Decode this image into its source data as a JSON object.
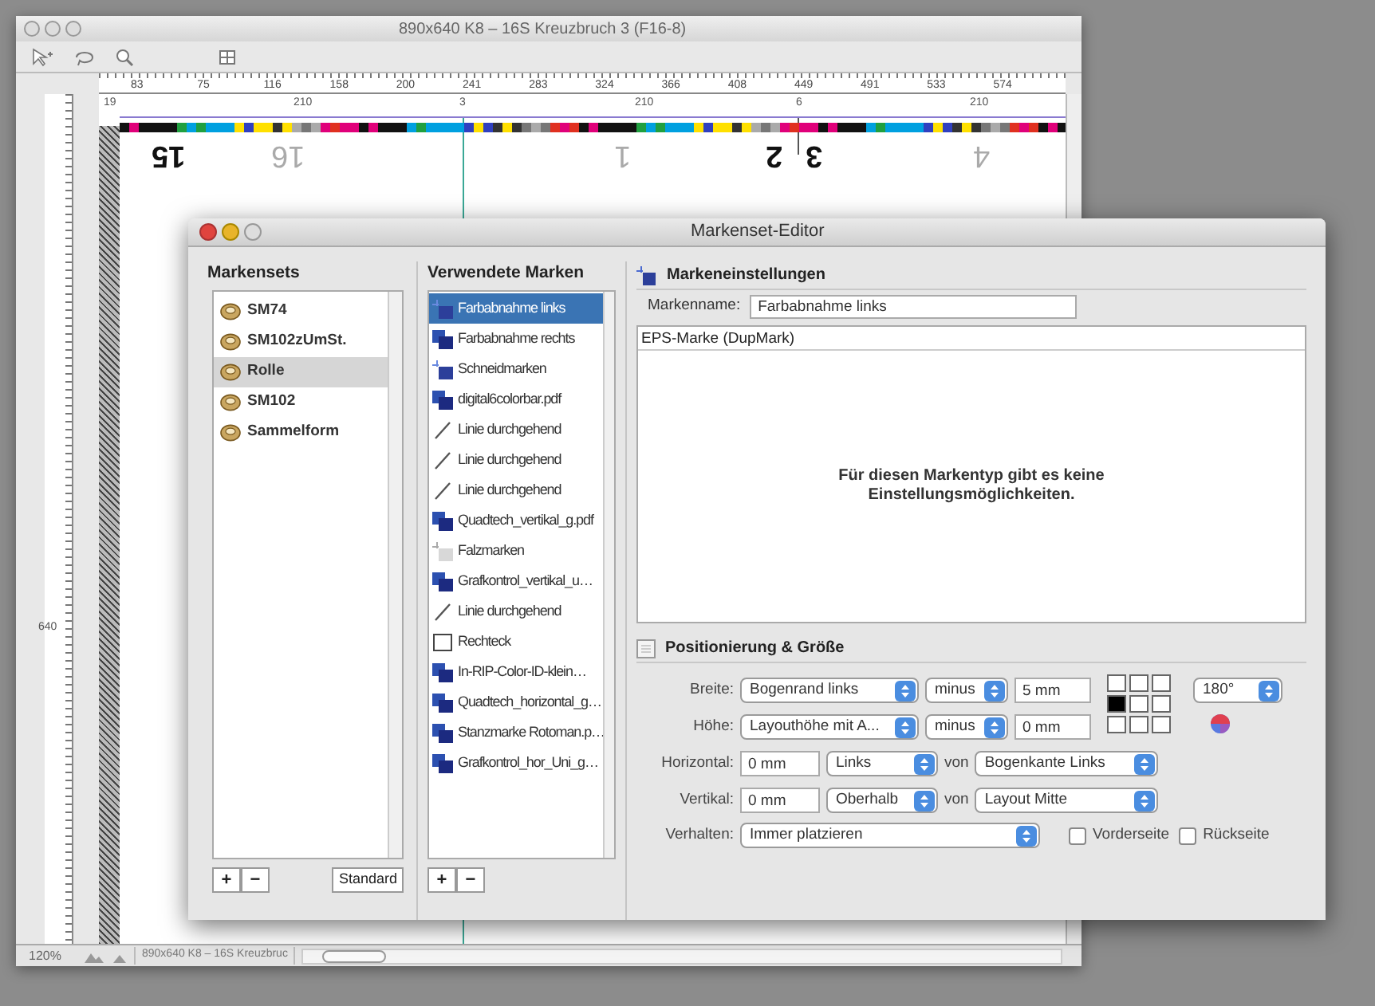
{
  "back_window": {
    "title": "890x640 K8 – 16S Kreuzbruch 3 (F16-8)",
    "ruler_ticks": [
      "83",
      "75",
      "116",
      "158",
      "200",
      "241",
      "283",
      "324",
      "366",
      "408",
      "449",
      "491",
      "533",
      "574"
    ],
    "sheet_labels": [
      {
        "text": "19"
      },
      {
        "text": "210"
      },
      {
        "text": "3"
      },
      {
        "text": "210"
      },
      {
        "text": "6"
      },
      {
        "text": "210"
      }
    ],
    "page_numbers": [
      {
        "text": "15",
        "highlighted": true
      },
      {
        "text": "16",
        "highlighted": false
      },
      {
        "text": "1",
        "highlighted": false
      },
      {
        "text": "2",
        "highlighted": true
      },
      {
        "text": "3",
        "highlighted": true
      },
      {
        "text": "4",
        "highlighted": false
      }
    ],
    "side_label": "640",
    "status_bar": {
      "zoom": "120%",
      "document": "890x640 K8 – 16S Kreuzbruc"
    }
  },
  "dialog": {
    "title": "Markenset-Editor",
    "markensets": {
      "heading": "Markensets",
      "items": [
        {
          "label": "SM74",
          "selected": false
        },
        {
          "label": "SM102zUmSt.",
          "selected": false
        },
        {
          "label": "Rolle",
          "selected": true
        },
        {
          "label": "SM102",
          "selected": false
        },
        {
          "label": "Sammelform",
          "selected": false
        }
      ],
      "buttons": [
        "+",
        "−"
      ],
      "standard_button": "Standard"
    },
    "used_marks": {
      "heading": "Verwendete Marken",
      "items": [
        {
          "label": "Farbabnahme links",
          "kind": "crop",
          "selected": true
        },
        {
          "label": "Farbabnahme rechts",
          "kind": "eps",
          "selected": false
        },
        {
          "label": "Schneidmarken",
          "kind": "crop",
          "selected": false
        },
        {
          "label": "digital6colorbar.pdf",
          "kind": "eps",
          "selected": false
        },
        {
          "label": "Linie durchgehend",
          "kind": "line",
          "selected": false
        },
        {
          "label": "Linie durchgehend",
          "kind": "line",
          "selected": false
        },
        {
          "label": "Linie durchgehend",
          "kind": "line",
          "selected": false
        },
        {
          "label": "Quadtech_vertikal_g.pdf",
          "kind": "eps",
          "selected": false
        },
        {
          "label": "Falzmarken",
          "kind": "fold",
          "selected": false
        },
        {
          "label": "Grafkontrol_vertikal_u…",
          "kind": "eps",
          "selected": false
        },
        {
          "label": "Linie durchgehend",
          "kind": "line",
          "selected": false
        },
        {
          "label": "Rechteck",
          "kind": "rect",
          "selected": false
        },
        {
          "label": "In-RIP-Color-ID-klein…",
          "kind": "eps",
          "selected": false
        },
        {
          "label": "Quadtech_horizontal_g…",
          "kind": "eps",
          "selected": false
        },
        {
          "label": "Stanzmarke Rotoman.p…",
          "kind": "eps",
          "selected": false
        },
        {
          "label": "Grafkontrol_hor_Uni_g…",
          "kind": "eps",
          "selected": false
        }
      ],
      "buttons": [
        "+",
        "−"
      ]
    },
    "settings": {
      "heading": "Markeneinstellungen",
      "name_label": "Markenname:",
      "name_value": "Farbabnahme links",
      "type_title": "EPS-Marke (DupMark)",
      "message": "Für diesen Markentyp gibt es keine Einstellungsmöglichkeiten."
    },
    "positioning": {
      "heading": "Positionierung & Größe",
      "width": {
        "label": "Breite:",
        "reference": "Bogenrand links",
        "operator": "minus",
        "offset": "5 mm"
      },
      "height": {
        "label": "Höhe:",
        "reference": "Layouthöhe mit A...",
        "operator": "minus",
        "offset": "0 mm"
      },
      "anchor": [
        {
          "selected": false
        },
        {
          "selected": false
        },
        {
          "selected": false
        },
        {
          "selected": true
        },
        {
          "selected": false
        },
        {
          "selected": false
        },
        {
          "selected": false
        },
        {
          "selected": false
        },
        {
          "selected": false
        }
      ],
      "rotation": "180°",
      "horizontal": {
        "label": "Horizontal:",
        "offset": "0 mm",
        "direction": "Links",
        "connector": "von",
        "reference": "Bogenkante Links"
      },
      "vertical": {
        "label": "Vertikal:",
        "offset": "0 mm",
        "direction": "Oberhalb",
        "connector": "von",
        "reference": "Layout Mitte"
      },
      "behavior": {
        "label": "Verhalten:",
        "value": "Immer platzieren"
      },
      "sides": [
        {
          "label": "Vorderseite",
          "checked": false
        },
        {
          "label": "Rückseite",
          "checked": false
        }
      ]
    }
  }
}
